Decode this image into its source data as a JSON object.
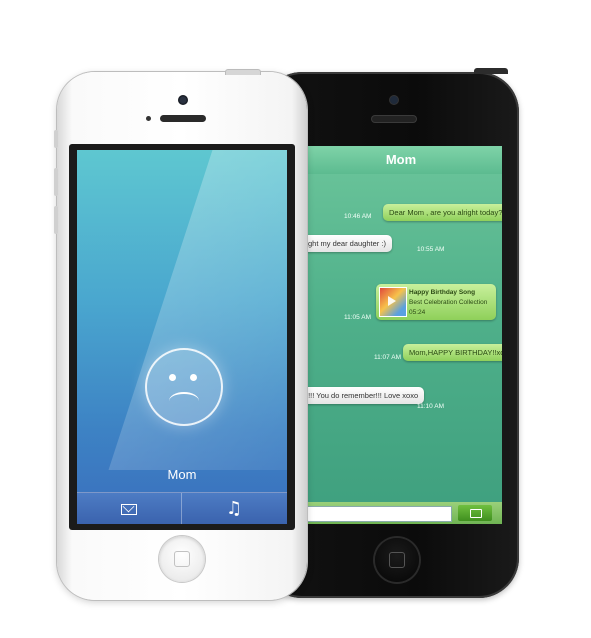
{
  "chat": {
    "title": "Mom",
    "messages": [
      {
        "direction": "out",
        "text": "Dear Mom , are you alright today?",
        "time": "10:46 AM"
      },
      {
        "direction": "in",
        "text": "alright my dear daughter :)",
        "time": "10:55 AM"
      },
      {
        "direction": "out",
        "type": "song",
        "song_title": "Happy Birthday Song",
        "song_album": "Best Celebration Collection",
        "song_duration": "05:24",
        "time": "11:05 AM"
      },
      {
        "direction": "out",
        "text": "Mom,HAPPY BIRTHDAY!!xoxo",
        "time": "11:07 AM"
      },
      {
        "direction": "in",
        "text": "MG!!! You do remember!!! Love xoxo",
        "time": "11:10 AM"
      }
    ],
    "input_placeholder": "",
    "send_icon": "message-send-icon"
  },
  "call": {
    "caller_name": "Mom",
    "avatar_icon": "sad-face-icon",
    "actions": [
      {
        "icon": "envelope-icon"
      },
      {
        "icon": "music-note-icon",
        "glyph": "♫"
      }
    ]
  },
  "colors": {
    "chat_bg": "#4fb08a",
    "outgoing_bubble": "#a8e070",
    "incoming_bubble": "#ffffff",
    "call_bg_top": "#5ec7d0",
    "call_bg_bottom": "#3a6fbd"
  }
}
